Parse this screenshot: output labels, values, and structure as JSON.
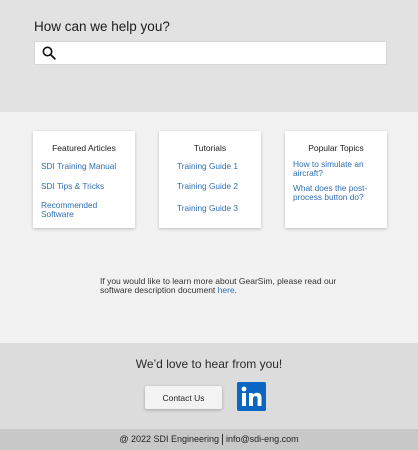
{
  "hero": {
    "title": "How can we help you?",
    "search_placeholder": "",
    "search_value": ""
  },
  "cards": [
    {
      "title": "Featured Articles",
      "links": [
        "SDI Training Manual",
        "SDI Tips & Tricks",
        "Recommended Software"
      ]
    },
    {
      "title": "Tutorials",
      "links": [
        "Training Guide 1",
        "Training Guide 2",
        "Training Guide 3"
      ]
    },
    {
      "title": "Popular Topics",
      "links": [
        "How to simulate an aircraft?",
        "What does the post-process button do?"
      ]
    }
  ],
  "info": {
    "text": "If you would like to learn more about GearSim, please read our software description document ",
    "link": "here",
    "suffix": "."
  },
  "contact": {
    "title": "We’d love to hear from you!",
    "button_label": "Contact Us",
    "social_icon": "linkedin-icon"
  },
  "footer": {
    "copyright": "@ 2022 SDI Engineering",
    "email": "info@sdi-eng.com"
  },
  "colors": {
    "link": "#2f6fb3",
    "linkedin": "#0a66c2",
    "hero_bg": "#e2e2e2",
    "footer_bg": "#c8c8c8"
  }
}
